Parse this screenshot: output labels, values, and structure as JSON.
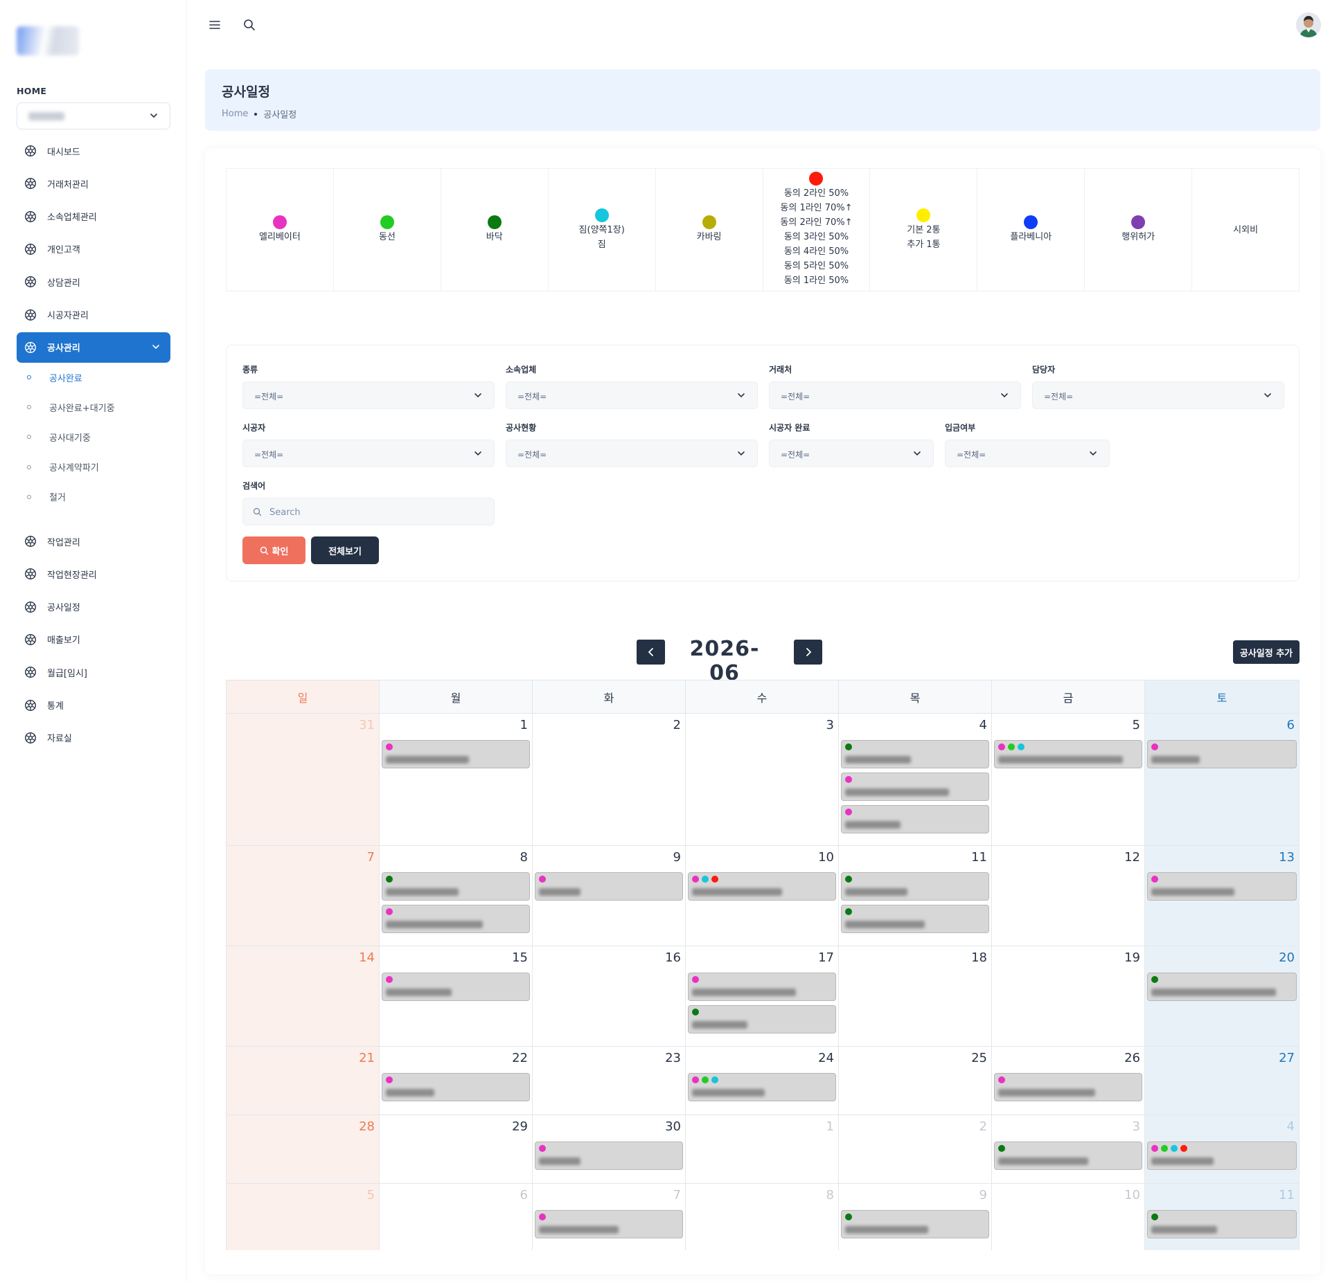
{
  "sidebar": {
    "section_label": "HOME",
    "company_select": {
      "value": ""
    },
    "items": [
      {
        "label": "대시보드"
      },
      {
        "label": "거래처관리"
      },
      {
        "label": "소속업체관리"
      },
      {
        "label": "개인고객"
      },
      {
        "label": "상담관리"
      },
      {
        "label": "시공자관리"
      },
      {
        "label": "공사관리",
        "active": true
      }
    ],
    "subitems": [
      {
        "label": "공사완료",
        "active": true
      },
      {
        "label": "공사완료+대기중"
      },
      {
        "label": "공사대기중"
      },
      {
        "label": "공사계약파기"
      },
      {
        "label": "철거"
      }
    ],
    "items2": [
      {
        "label": "작업관리"
      },
      {
        "label": "작업현장관리"
      },
      {
        "label": "공사일정"
      },
      {
        "label": "매출보기"
      },
      {
        "label": "월급[임시]"
      },
      {
        "label": "통계"
      },
      {
        "label": "자료실"
      }
    ]
  },
  "topbar": {
    "menu_icon": "menu-icon",
    "search_icon": "search-icon",
    "avatar_icon": "user-avatar"
  },
  "page": {
    "title": "공사일정",
    "breadcrumb_home": "Home",
    "breadcrumb_current": "공사일정"
  },
  "legend": [
    {
      "color": "#e833c0",
      "lines": [
        "엘리베이터"
      ]
    },
    {
      "color": "#22cc22",
      "lines": [
        "동선"
      ]
    },
    {
      "color": "#0b7a12",
      "lines": [
        "바닥"
      ]
    },
    {
      "color": "#16c6dc",
      "lines": [
        "짐(양쪽1장)",
        "짐"
      ]
    },
    {
      "color": "#b8ac08",
      "lines": [
        "카바링"
      ]
    },
    {
      "color": "#ff1a0d",
      "lines": [
        "동의 2라인 50%",
        "동의 1라인 70%↑",
        "동의 2라인 70%↑",
        "동의 3라인 50%",
        "동의 4라인 50%",
        "동의 5라인 50%",
        "동의 1라인 50%"
      ]
    },
    {
      "color": "#ffee00",
      "lines": [
        "기본 2통",
        "추가 1통"
      ]
    },
    {
      "color": "#0f3cf5",
      "lines": [
        "플라베니아"
      ]
    },
    {
      "color": "#7f3fae",
      "lines": [
        "행위허가"
      ]
    },
    {
      "color": "",
      "lines": [
        "시외비"
      ]
    }
  ],
  "filters": {
    "type": {
      "label": "종류",
      "value": "=전체="
    },
    "subcontractor": {
      "label": "소속업체",
      "value": "=전체="
    },
    "client": {
      "label": "거래처",
      "value": "=전체="
    },
    "manager": {
      "label": "담당자",
      "value": "=전체="
    },
    "builder": {
      "label": "시공자",
      "value": "=전체="
    },
    "status": {
      "label": "공사현황",
      "value": "=전체="
    },
    "builder_done": {
      "label": "시공자 완료",
      "value": "=전체="
    },
    "payment": {
      "label": "입금여부",
      "value": "=전체="
    },
    "search": {
      "label": "검색어",
      "placeholder": "Search",
      "value": ""
    },
    "ok_label": "확인",
    "all_label": "전체보기"
  },
  "calendar": {
    "title": "2026-06",
    "add_label": "공사일정 추가",
    "weekdays": [
      "일",
      "월",
      "화",
      "수",
      "목",
      "금",
      "토"
    ],
    "weeks": [
      [
        {
          "day": 31,
          "out": true,
          "events": []
        },
        {
          "day": 1,
          "events": [
            [
              "#e833c0"
            ]
          ]
        },
        {
          "day": 2,
          "events": []
        },
        {
          "day": 3,
          "events": []
        },
        {
          "day": 4,
          "events": [
            [
              "#0b7a12"
            ],
            [
              "#e833c0"
            ],
            [
              "#e833c0"
            ]
          ]
        },
        {
          "day": 5,
          "events": [
            [
              "#e833c0",
              "#22cc22",
              "#16c6dc"
            ]
          ]
        },
        {
          "day": 6,
          "events": [
            [
              "#e833c0"
            ]
          ]
        }
      ],
      [
        {
          "day": 7,
          "events": []
        },
        {
          "day": 8,
          "events": [
            [
              "#0b7a12"
            ],
            [
              "#e833c0"
            ]
          ]
        },
        {
          "day": 9,
          "events": [
            [
              "#e833c0"
            ]
          ]
        },
        {
          "day": 10,
          "events": [
            [
              "#e833c0",
              "#16c6dc",
              "#ff1a0d"
            ]
          ]
        },
        {
          "day": 11,
          "events": [
            [
              "#0b7a12"
            ],
            [
              "#0b7a12"
            ]
          ]
        },
        {
          "day": 12,
          "events": []
        },
        {
          "day": 13,
          "events": [
            [
              "#e833c0"
            ]
          ]
        }
      ],
      [
        {
          "day": 14,
          "events": []
        },
        {
          "day": 15,
          "events": [
            [
              "#e833c0"
            ]
          ]
        },
        {
          "day": 16,
          "events": []
        },
        {
          "day": 17,
          "events": [
            [
              "#e833c0"
            ],
            [
              "#0b7a12"
            ]
          ]
        },
        {
          "day": 18,
          "events": []
        },
        {
          "day": 19,
          "events": []
        },
        {
          "day": 20,
          "events": [
            [
              "#0b7a12"
            ]
          ]
        }
      ],
      [
        {
          "day": 21,
          "events": []
        },
        {
          "day": 22,
          "events": [
            [
              "#e833c0"
            ]
          ]
        },
        {
          "day": 23,
          "events": []
        },
        {
          "day": 24,
          "events": [
            [
              "#e833c0",
              "#22cc22",
              "#16c6dc"
            ]
          ]
        },
        {
          "day": 25,
          "events": []
        },
        {
          "day": 26,
          "events": [
            [
              "#e833c0"
            ]
          ]
        },
        {
          "day": 27,
          "events": []
        }
      ],
      [
        {
          "day": 28,
          "events": []
        },
        {
          "day": 29,
          "events": []
        },
        {
          "day": 30,
          "events": [
            [
              "#e833c0"
            ]
          ]
        },
        {
          "day": 1,
          "out": true,
          "events": []
        },
        {
          "day": 2,
          "out": true,
          "events": []
        },
        {
          "day": 3,
          "out": true,
          "events": [
            [
              "#0b7a12"
            ]
          ]
        },
        {
          "day": 4,
          "out": true,
          "events": [
            [
              "#e833c0",
              "#22cc22",
              "#16c6dc",
              "#ff1a0d"
            ]
          ]
        }
      ],
      [
        {
          "day": 5,
          "out": true,
          "events": []
        },
        {
          "day": 6,
          "out": true,
          "events": []
        },
        {
          "day": 7,
          "out": true,
          "events": [
            [
              "#e833c0"
            ]
          ]
        },
        {
          "day": 8,
          "out": true,
          "events": []
        },
        {
          "day": 9,
          "out": true,
          "events": [
            [
              "#0b7a12"
            ]
          ]
        },
        {
          "day": 10,
          "out": true,
          "events": []
        },
        {
          "day": 11,
          "out": true,
          "events": [
            [
              "#0b7a12"
            ]
          ]
        }
      ]
    ]
  }
}
